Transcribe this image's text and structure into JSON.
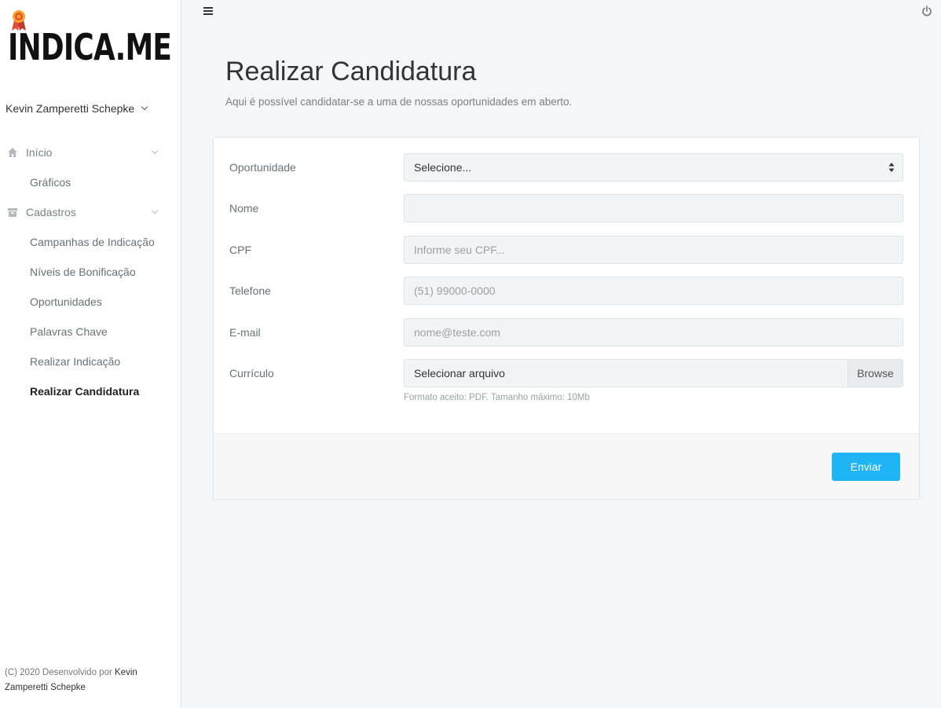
{
  "app": {
    "logo_text": "INDICA.ME"
  },
  "user": {
    "name": "Kevin Zamperetti Schepke"
  },
  "sidebar": {
    "groups": [
      {
        "label": "Início",
        "icon": "home-icon",
        "items": [
          {
            "label": "Gráficos"
          }
        ]
      },
      {
        "label": "Cadastros",
        "icon": "archive-icon",
        "items": [
          {
            "label": "Campanhas de Indicação"
          },
          {
            "label": "Níveis de Bonificação"
          },
          {
            "label": "Oportunidades"
          },
          {
            "label": "Palavras Chave"
          },
          {
            "label": "Realizar Indicação"
          },
          {
            "label": "Realizar Candidatura"
          }
        ]
      }
    ],
    "active_item": "Realizar Candidatura"
  },
  "footer": {
    "prefix": "(C) 2020 Desenvolvido por ",
    "author": "Kevin Zamperetti Schepke"
  },
  "topbar": {
    "menu_icon": "hamburger-icon",
    "logout_icon": "power-icon"
  },
  "page": {
    "title": "Realizar Candidatura",
    "subtitle": "Aqui é possível candidatar-se a uma de nossas oportunidades em aberto."
  },
  "form": {
    "oportunidade": {
      "label": "Oportunidade",
      "value": "Selecione..."
    },
    "nome": {
      "label": "Nome",
      "value": "",
      "placeholder": ""
    },
    "cpf": {
      "label": "CPF",
      "value": "",
      "placeholder": "Informe seu CPF..."
    },
    "telefone": {
      "label": "Telefone",
      "value": "",
      "placeholder": "(51) 99000-0000"
    },
    "email": {
      "label": "E-mail",
      "value": "",
      "placeholder": "nome@teste.com"
    },
    "curriculo": {
      "label": "Currículo",
      "value": "Selecionar arquivo",
      "browse_label": "Browse",
      "help": "Formato aceito: PDF. Tamanho máximo: 10Mb"
    },
    "submit_label": "Enviar"
  },
  "colors": {
    "primary_button": "#1fb5f5",
    "background": "#f5f6f8"
  }
}
